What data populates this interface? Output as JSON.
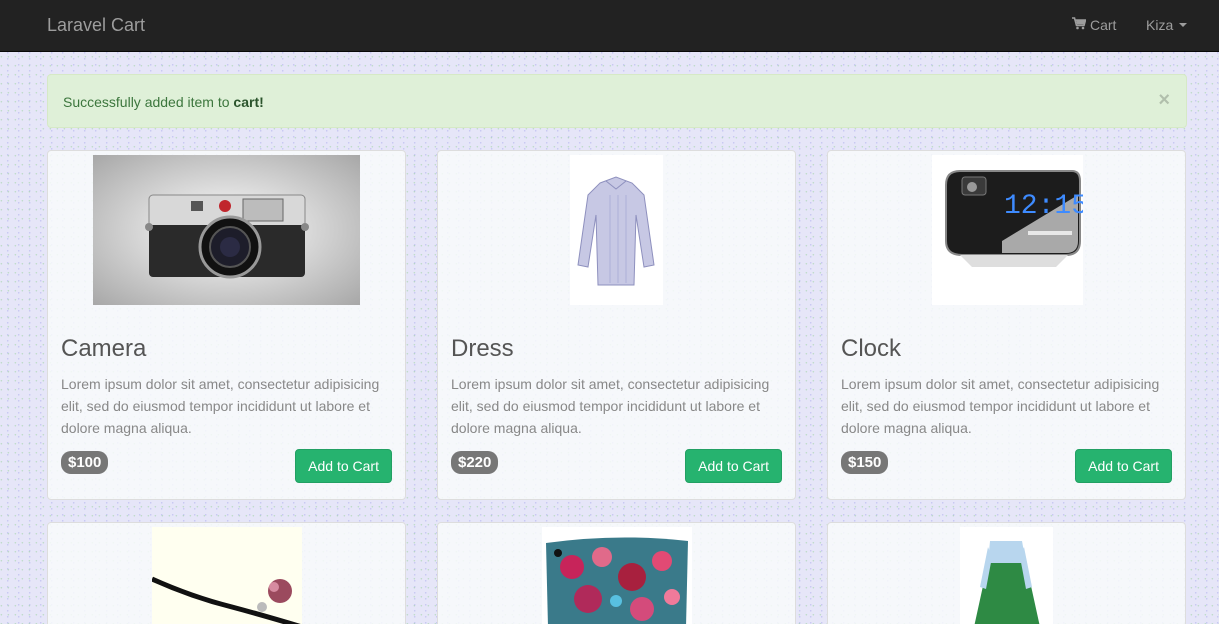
{
  "navbar": {
    "brand": "Laravel Cart",
    "cart_label": "Cart",
    "user_label": "Kiza"
  },
  "alert": {
    "text": "Successfully added item to ",
    "bold": "cart!",
    "close": "×"
  },
  "products": [
    {
      "title": "Camera",
      "description": "Lorem ipsum dolor sit amet, consectetur adipisicing elit, sed do eiusmod tempor incididunt ut labore et dolore magna aliqua.",
      "price": "$100",
      "button": "Add to Cart"
    },
    {
      "title": "Dress",
      "description": "Lorem ipsum dolor sit amet, consectetur adipisicing elit, sed do eiusmod tempor incididunt ut labore et dolore magna aliqua.",
      "price": "$220",
      "button": "Add to Cart"
    },
    {
      "title": "Clock",
      "description": "Lorem ipsum dolor sit amet, consectetur adipisicing elit, sed do eiusmod tempor incididunt ut labore et dolore magna aliqua.",
      "price": "$150",
      "button": "Add to Cart"
    }
  ],
  "colors": {
    "navbar_bg": "#222222",
    "button_green": "#26b36f",
    "alert_bg": "#dff0d8",
    "price_badge": "#777777"
  }
}
